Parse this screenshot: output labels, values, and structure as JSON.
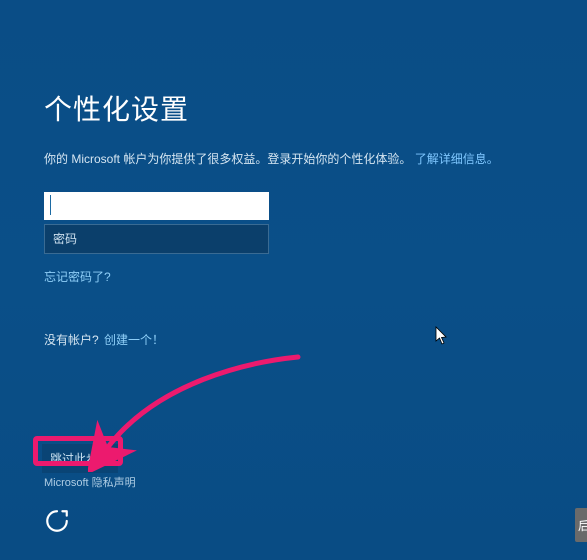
{
  "title": "个性化设置",
  "subtitle_pre": "你的 Microsoft 帐户为你提供了很多权益。登录开始你的个性化体验。",
  "subtitle_link": "了解详细信息。",
  "email_value": "",
  "password_placeholder": "密码",
  "forgot_label": "忘记密码了?",
  "noaccount_text": "没有帐户?",
  "noaccount_link": "创建一个！",
  "skip_label": "跳过此步骤",
  "privacy_label": "Microsoft 隐私声明",
  "right_button_fragment": "后"
}
